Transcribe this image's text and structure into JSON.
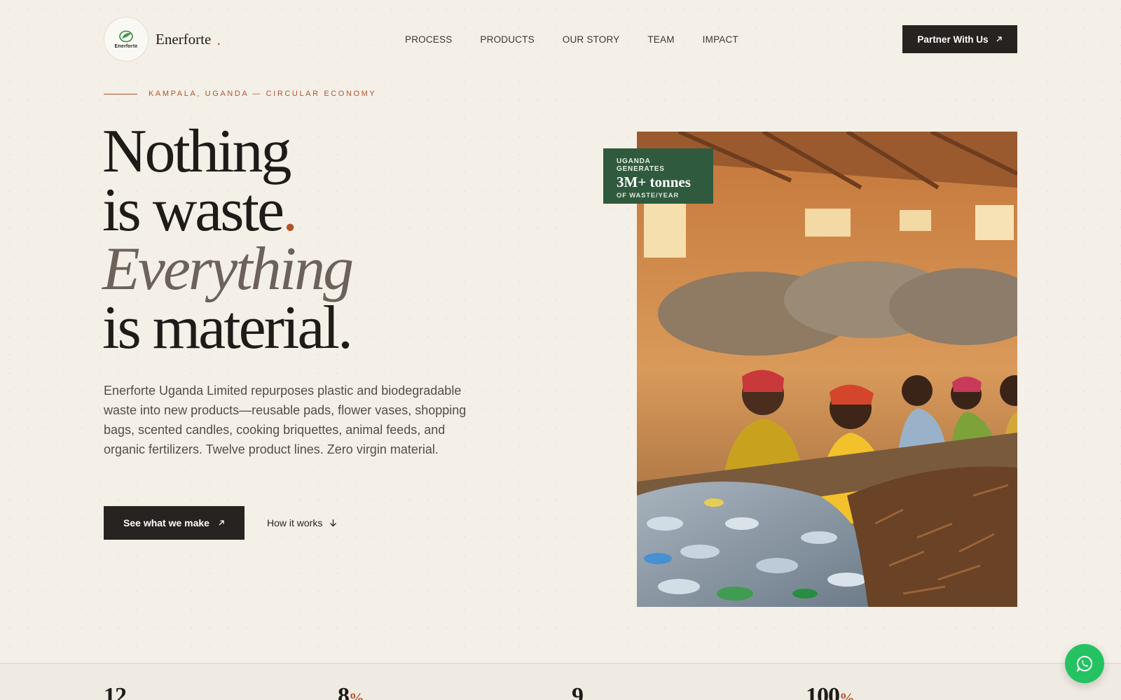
{
  "brand": {
    "name": "Enerforte",
    "badge_text": "Enerforte",
    "dot": "."
  },
  "nav": {
    "links": [
      "PROCESS",
      "PRODUCTS",
      "OUR STORY",
      "TEAM",
      "IMPACT"
    ],
    "cta": "Partner With Us"
  },
  "hero": {
    "eyebrow": "KAMPALA, UGANDA — CIRCULAR ECONOMY",
    "line1": "Nothing",
    "line2": "is waste",
    "line2_accent": ".",
    "line3": "Everything",
    "line4": "is material.",
    "description": "Enerforte Uganda Limited repurposes plastic and biodegradable waste into new products—reusable pads, flower vases, shopping bags, scented candles, cooking briquettes, animal feeds, and organic fertilizers. Twelve product lines. Zero virgin material.",
    "primary_button": "See what we make",
    "secondary_button": "How it works"
  },
  "stat_badge": {
    "label_top": "UGANDA GENERATES",
    "value": "3M+ tonnes",
    "label_bottom": "OF WASTE/YEAR"
  },
  "stats": [
    {
      "value": "12",
      "suffix": ""
    },
    {
      "value": "8",
      "suffix": "%"
    },
    {
      "value": "9",
      "suffix": ""
    },
    {
      "value": "100",
      "suffix": "%"
    }
  ],
  "colors": {
    "accent": "#b2532c",
    "dark": "#272320",
    "green": "#2f5a3e",
    "whatsapp": "#25c262",
    "background": "#f4f0e8"
  },
  "icons": {
    "whatsapp": "whatsapp-icon",
    "arrow_ne": "arrow-up-right-icon",
    "arrow_down": "arrow-down-icon"
  }
}
